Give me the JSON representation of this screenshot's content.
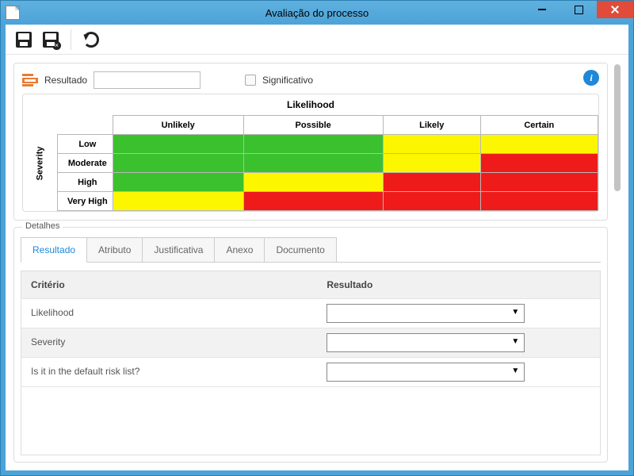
{
  "window": {
    "title": "Avaliação do processo"
  },
  "toolbar": {
    "save_title": "Salvar",
    "saveclose_title": "Salvar e fechar",
    "refresh_title": "Atualizar"
  },
  "top_panel": {
    "result_label": "Resultado",
    "result_value": "",
    "significant_label": "Significativo",
    "significant_checked": false,
    "info_tooltip": "Info"
  },
  "matrix": {
    "title": "Likelihood",
    "side_label": "Severity",
    "columns": [
      "Unlikely",
      "Possible",
      "Likely",
      "Certain"
    ],
    "rows": [
      {
        "label": "Low",
        "cells": [
          "g",
          "g",
          "y",
          "y"
        ]
      },
      {
        "label": "Moderate",
        "cells": [
          "g",
          "g",
          "y",
          "r"
        ]
      },
      {
        "label": "High",
        "cells": [
          "g",
          "y",
          "r",
          "r"
        ]
      },
      {
        "label": "Very High",
        "cells": [
          "y",
          "r",
          "r",
          "r"
        ]
      }
    ]
  },
  "details": {
    "legend": "Detalhes",
    "tabs": [
      "Resultado",
      "Atributo",
      "Justificativa",
      "Anexo",
      "Documento"
    ],
    "active_tab": 0,
    "grid_headers": {
      "criterion": "Critério",
      "result": "Resultado"
    },
    "rows": [
      {
        "criterion": "Likelihood",
        "value": ""
      },
      {
        "criterion": "Severity",
        "value": ""
      },
      {
        "criterion": "Is it in the default risk list?",
        "value": ""
      }
    ]
  }
}
